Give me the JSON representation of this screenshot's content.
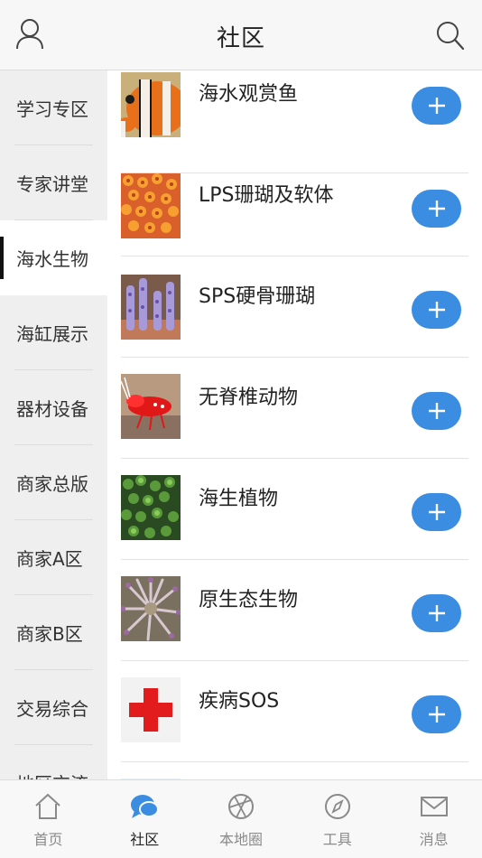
{
  "header": {
    "title": "社区",
    "user_icon": "user-icon",
    "search_icon": "search-icon"
  },
  "sidebar": {
    "items": [
      {
        "label": "学习专区"
      },
      {
        "label": "专家讲堂"
      },
      {
        "label": "海水生物",
        "active": true
      },
      {
        "label": "海缸展示"
      },
      {
        "label": "器材设备"
      },
      {
        "label": "商家总版"
      },
      {
        "label": "商家A区"
      },
      {
        "label": "商家B区"
      },
      {
        "label": "交易综合"
      },
      {
        "label": "地区交流"
      }
    ]
  },
  "list": {
    "items": [
      {
        "name": "海水观赏鱼",
        "thumb": "clownfish-image"
      },
      {
        "name": "LPS珊瑚及软体",
        "thumb": "lps-coral-image"
      },
      {
        "name": "SPS硬骨珊瑚",
        "thumb": "sps-coral-image"
      },
      {
        "name": "无脊椎动物",
        "thumb": "shrimp-image"
      },
      {
        "name": "海生植物",
        "thumb": "marine-plant-image"
      },
      {
        "name": "原生态生物",
        "thumb": "anemone-image"
      },
      {
        "name": "疾病SOS",
        "thumb": "red-cross-image"
      }
    ],
    "add_icon": "plus-icon"
  },
  "tabbar": {
    "tabs": [
      {
        "label": "首页",
        "icon": "home-icon"
      },
      {
        "label": "社区",
        "icon": "chat-bubble-icon",
        "active": true
      },
      {
        "label": "本地圈",
        "icon": "aperture-icon"
      },
      {
        "label": "工具",
        "icon": "compass-icon"
      },
      {
        "label": "消息",
        "icon": "mail-icon"
      }
    ]
  },
  "colors": {
    "accent": "#3a8de0",
    "active_tab_icon": "#3a8de0",
    "sidebar_bg": "#efefef"
  }
}
